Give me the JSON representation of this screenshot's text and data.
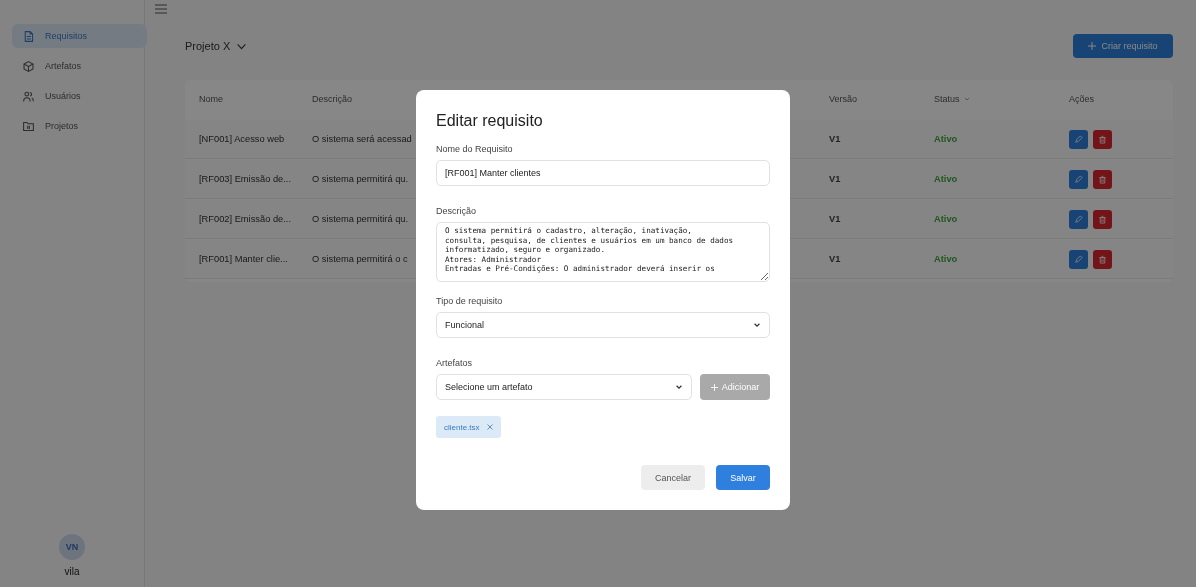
{
  "sidebar": {
    "items": [
      {
        "label": "Requisitos",
        "selected": true
      },
      {
        "label": "Artefatos",
        "selected": false
      },
      {
        "label": "Usuários",
        "selected": false
      },
      {
        "label": "Projetos",
        "selected": false
      }
    ],
    "user": {
      "initials": "VN",
      "name": "vila"
    }
  },
  "header": {
    "project": "Projeto X",
    "create_button": "Criar requisito"
  },
  "table": {
    "columns": [
      "Nome",
      "Descrição",
      "Versão",
      "Status",
      "Ações"
    ],
    "rows": [
      {
        "name": "[NF001] Acesso web",
        "description": "O sistema será acessad",
        "version": "V1",
        "status": "Ativo"
      },
      {
        "name": "[RF003] Emissão de...",
        "description": "O sistema permitirá qu.",
        "version": "V1",
        "status": "Ativo"
      },
      {
        "name": "[RF002] Emissão de...",
        "description": "O sistema permitirá qu.",
        "version": "V1",
        "status": "Ativo"
      },
      {
        "name": "[RF001] Manter clie...",
        "description": "O sistema permitirá o c",
        "version": "V1",
        "status": "Ativo"
      }
    ]
  },
  "modal": {
    "title": "Editar requisito",
    "name_field": {
      "label": "Nome do Requisito",
      "value": "[RF001] Manter clientes"
    },
    "description_field": {
      "label": "Descrição",
      "value": "O sistema permitirá o cadastro, alteração, inativação,\nconsulta, pesquisa, de clientes e usuários em um banco de dados\ninformatizado, seguro e organizado.\nAtores: Administrador\nEntradas e Pré-Condições: O administrador deverá inserir os"
    },
    "type_field": {
      "label": "Tipo de requisito",
      "value": "Funcional"
    },
    "artifacts_field": {
      "label": "Artefatos",
      "value": "Selecione um artefato",
      "add_button": {
        "label": "Adicionar",
        "disabled": true
      }
    },
    "chips": [
      {
        "label": "cliente.tsx"
      }
    ],
    "buttons": [
      {
        "label": "Cancelar",
        "kind": "secondary"
      },
      {
        "label": "Salvar",
        "kind": "primary"
      }
    ]
  }
}
